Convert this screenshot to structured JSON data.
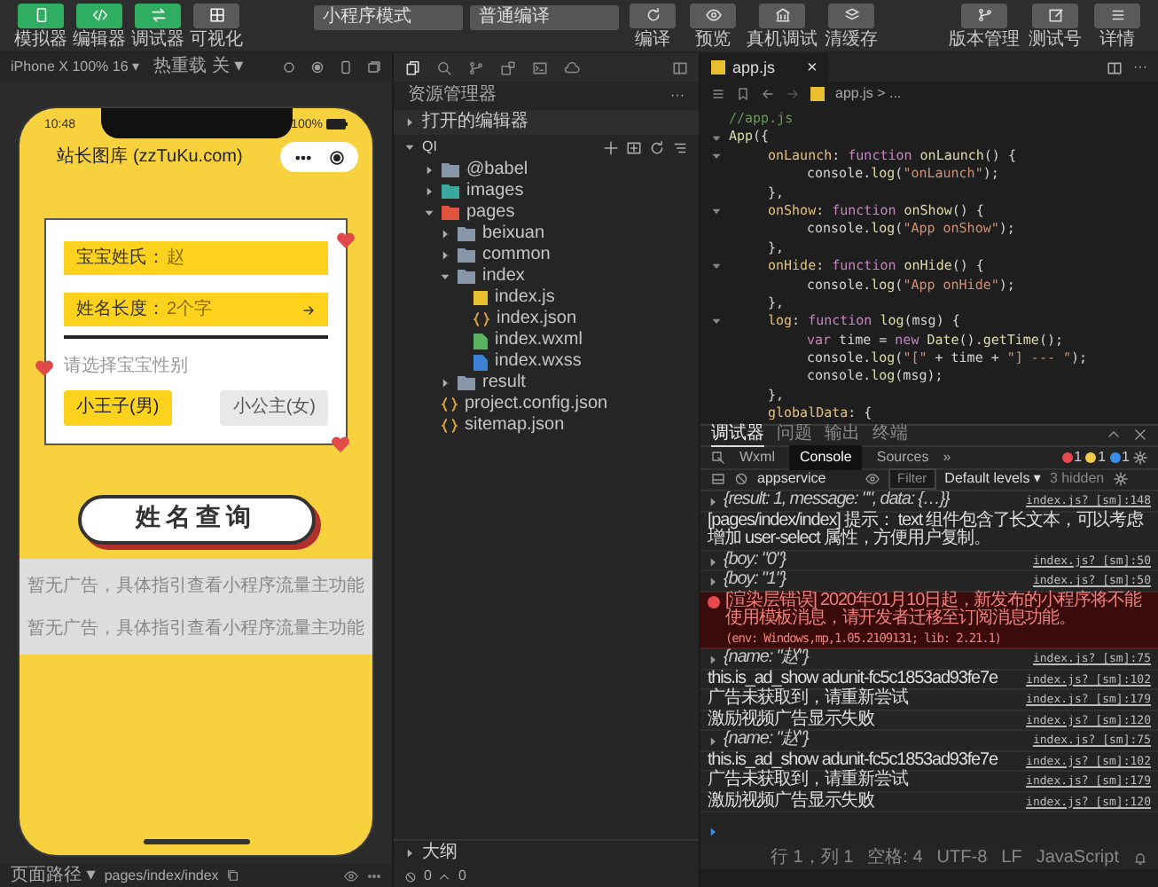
{
  "toolbar": {
    "views": [
      {
        "label": "模拟器",
        "on": true
      },
      {
        "label": "编辑器",
        "on": true
      },
      {
        "label": "调试器",
        "on": true
      },
      {
        "label": "可视化",
        "on": false
      }
    ],
    "mode": "小程序模式",
    "compile": "普通编译",
    "actions": [
      {
        "label": "编译"
      },
      {
        "label": "预览"
      },
      {
        "label": "真机调试"
      },
      {
        "label": "清缓存"
      }
    ],
    "right": [
      {
        "label": "版本管理"
      },
      {
        "label": "测试号"
      },
      {
        "label": "详情"
      }
    ]
  },
  "simulator": {
    "device": "iPhone X 100% 16 ▾",
    "hot_reload": "热重载 关 ▾",
    "phone": {
      "time": "10:48",
      "battery": "100%",
      "title": "站长图库 (zzTuKu.com)",
      "fields": [
        {
          "label": "宝宝姓氏：",
          "value": "赵",
          "arrow": false
        },
        {
          "label": "姓名长度：",
          "value": "2个字",
          "arrow": true
        }
      ],
      "gender_prompt": "请选择宝宝性别",
      "genders": [
        {
          "label": "小王子(男)",
          "selected": true
        },
        {
          "label": "小公主(女)",
          "selected": false
        }
      ],
      "submit": "姓名查询",
      "ads": [
        "暂无广告，具体指引查看小程序流量主功能",
        "暂无广告，具体指引查看小程序流量主功能"
      ]
    },
    "page_path_label": "页面路径 ▾",
    "page_path": "pages/index/index"
  },
  "explorer": {
    "title": "资源管理器",
    "more": "···",
    "open_editors": {
      "label": "打开的编辑器",
      "expanded": false
    },
    "project": {
      "label": "QI",
      "expanded": true,
      "children": [
        {
          "name": "@babel",
          "kind": "folder",
          "color": "#8796a8",
          "expanded": false
        },
        {
          "name": "images",
          "kind": "folder",
          "color": "#3aa89c",
          "expanded": false
        },
        {
          "name": "pages",
          "kind": "folder",
          "color": "#e0533f",
          "expanded": true,
          "children": [
            {
              "name": "beixuan",
              "kind": "folder",
              "color": "#8796a8",
              "expanded": false
            },
            {
              "name": "common",
              "kind": "folder",
              "color": "#8796a8",
              "expanded": false
            },
            {
              "name": "index",
              "kind": "folder",
              "color": "#8796a8",
              "expanded": true,
              "children": [
                {
                  "name": "index.js",
                  "kind": "js"
                },
                {
                  "name": "index.json",
                  "kind": "json"
                },
                {
                  "name": "index.wxml",
                  "kind": "wxml"
                },
                {
                  "name": "index.wxss",
                  "kind": "wxss"
                }
              ]
            },
            {
              "name": "result",
              "kind": "folder",
              "color": "#8796a8",
              "expanded": false
            }
          ]
        },
        {
          "name": "project.config.json",
          "kind": "json"
        },
        {
          "name": "sitemap.json",
          "kind": "json"
        }
      ]
    },
    "outline": "大纲",
    "errors": "0",
    "warnings": "0"
  },
  "editor": {
    "tab": "app.js",
    "close": "×",
    "breadcrumb": "app.js > ...",
    "more": "···",
    "lines": [
      {
        "tokens": [
          {
            "kind": "comment",
            "text": "//app.js"
          }
        ]
      },
      {
        "tokens": [
          {
            "kind": "fn",
            "text": "App"
          },
          {
            "kind": "plain",
            "text": "({"
          }
        ],
        "children": [
          {
            "tokens": [
              {
                "kind": "key",
                "text": "onLaunch"
              },
              {
                "kind": "plain",
                "text": ": "
              },
              {
                "kind": "kw",
                "text": "function"
              },
              {
                "kind": "fn",
                "text": " onLaunch"
              },
              {
                "kind": "plain",
                "text": "() {"
              }
            ],
            "children": [
              {
                "tokens": [
                  {
                    "kind": "plain",
                    "text": "console."
                  },
                  {
                    "kind": "fn",
                    "text": "log"
                  },
                  {
                    "kind": "plain",
                    "text": "("
                  },
                  {
                    "kind": "str",
                    "text": "\"onLaunch\""
                  },
                  {
                    "kind": "plain",
                    "text": ");"
                  }
                ]
              }
            ]
          },
          {
            "tokens": [
              {
                "kind": "plain",
                "text": "},"
              }
            ]
          },
          {
            "tokens": [
              {
                "kind": "key",
                "text": "onShow"
              },
              {
                "kind": "plain",
                "text": ": "
              },
              {
                "kind": "kw",
                "text": "function"
              },
              {
                "kind": "fn",
                "text": " onShow"
              },
              {
                "kind": "plain",
                "text": "() {"
              }
            ],
            "children": [
              {
                "tokens": [
                  {
                    "kind": "plain",
                    "text": "console."
                  },
                  {
                    "kind": "fn",
                    "text": "log"
                  },
                  {
                    "kind": "plain",
                    "text": "("
                  },
                  {
                    "kind": "str",
                    "text": "\"App onShow\""
                  },
                  {
                    "kind": "plain",
                    "text": ");"
                  }
                ]
              }
            ]
          },
          {
            "tokens": [
              {
                "kind": "plain",
                "text": "},"
              }
            ]
          },
          {
            "tokens": [
              {
                "kind": "key",
                "text": "onHide"
              },
              {
                "kind": "plain",
                "text": ": "
              },
              {
                "kind": "kw",
                "text": "function"
              },
              {
                "kind": "fn",
                "text": " onHide"
              },
              {
                "kind": "plain",
                "text": "() {"
              }
            ],
            "children": [
              {
                "tokens": [
                  {
                    "kind": "plain",
                    "text": "console."
                  },
                  {
                    "kind": "fn",
                    "text": "log"
                  },
                  {
                    "kind": "plain",
                    "text": "("
                  },
                  {
                    "kind": "str",
                    "text": "\"App onHide\""
                  },
                  {
                    "kind": "plain",
                    "text": ");"
                  }
                ]
              }
            ]
          },
          {
            "tokens": [
              {
                "kind": "plain",
                "text": "},"
              }
            ]
          },
          {
            "tokens": [
              {
                "kind": "key",
                "text": "log"
              },
              {
                "kind": "plain",
                "text": ": "
              },
              {
                "kind": "kw",
                "text": "function"
              },
              {
                "kind": "fn",
                "text": " log"
              },
              {
                "kind": "plain",
                "text": "(msg) {"
              }
            ],
            "children": [
              {
                "tokens": [
                  {
                    "kind": "kw",
                    "text": "var"
                  },
                  {
                    "kind": "plain",
                    "text": " time = "
                  },
                  {
                    "kind": "kw",
                    "text": "new"
                  },
                  {
                    "kind": "fn",
                    "text": " Date"
                  },
                  {
                    "kind": "plain",
                    "text": "()."
                  },
                  {
                    "kind": "fn",
                    "text": "getTime"
                  },
                  {
                    "kind": "plain",
                    "text": "();"
                  }
                ]
              },
              {
                "tokens": [
                  {
                    "kind": "plain",
                    "text": "console."
                  },
                  {
                    "kind": "fn",
                    "text": "log"
                  },
                  {
                    "kind": "plain",
                    "text": "("
                  },
                  {
                    "kind": "str",
                    "text": "\"[\""
                  },
                  {
                    "kind": "plain",
                    "text": " + time + "
                  },
                  {
                    "kind": "str",
                    "text": "\"] --- \""
                  },
                  {
                    "kind": "plain",
                    "text": ");"
                  }
                ]
              },
              {
                "tokens": [
                  {
                    "kind": "plain",
                    "text": "console."
                  },
                  {
                    "kind": "fn",
                    "text": "log"
                  },
                  {
                    "kind": "plain",
                    "text": "(msg);"
                  }
                ]
              }
            ]
          },
          {
            "tokens": [
              {
                "kind": "plain",
                "text": "},"
              }
            ]
          },
          {
            "tokens": [
              {
                "kind": "key",
                "text": "globalData"
              },
              {
                "kind": "plain",
                "text": ": {"
              }
            ]
          }
        ]
      }
    ]
  },
  "console": {
    "panel_tabs": [
      {
        "label": "调试器",
        "selected": true
      },
      {
        "label": "问题",
        "selected": false
      },
      {
        "label": "输出",
        "selected": false
      },
      {
        "label": "终端",
        "selected": false
      }
    ],
    "devtools_tabs": [
      {
        "label": "Wxml",
        "selected": false
      },
      {
        "label": "Console",
        "selected": true
      },
      {
        "label": "Sources",
        "selected": false
      }
    ],
    "overflow": "»",
    "counts": [
      {
        "kind": "error",
        "count": "1"
      },
      {
        "kind": "warning",
        "count": "1"
      },
      {
        "kind": "info",
        "count": "1"
      }
    ],
    "context": "appservice",
    "filter_placeholder": "Filter",
    "levels": "Default levels ▾",
    "hidden": "3 hidden",
    "entries": [
      {
        "kind": "object",
        "text": "{result: 1, message: \"\", data: {…}}",
        "source": "index.js? [sm]:148"
      },
      {
        "kind": "text",
        "text": "[pages/index/index] 提示： text 组件包含了长文本，可以考虑增加 user-select 属性，方便用户复制。"
      },
      {
        "kind": "object",
        "text": "{boy: \"0\"}",
        "source": "index.js? [sm]:50"
      },
      {
        "kind": "object",
        "text": "{boy: \"1\"}",
        "source": "index.js? [sm]:50"
      },
      {
        "kind": "error",
        "text": "[渲染层错误] 2020年01月10日起，新发布的小程序将不能使用模板消息，请开发者迁移至订阅消息功能。",
        "detail": "(env: Windows,mp,1.05.2109131; lib: 2.21.1)"
      },
      {
        "kind": "object",
        "text": "{name: \"赵\"}",
        "source": "index.js? [sm]:75"
      },
      {
        "kind": "text",
        "text": "this.is_ad_show adunit-fc5c1853ad93fe7e",
        "source": "index.js? [sm]:102"
      },
      {
        "kind": "text",
        "text": "广告未获取到，请重新尝试",
        "source": "index.js? [sm]:179"
      },
      {
        "kind": "text",
        "text": "激励视频广告显示失败",
        "source": "index.js? [sm]:120"
      },
      {
        "kind": "object",
        "text": "{name: \"赵\"}",
        "source": "index.js? [sm]:75"
      },
      {
        "kind": "text",
        "text": "this.is_ad_show adunit-fc5c1853ad93fe7e",
        "source": "index.js? [sm]:102"
      },
      {
        "kind": "text",
        "text": "广告未获取到，请重新尝试",
        "source": "index.js? [sm]:179"
      },
      {
        "kind": "text",
        "text": "激励视频广告显示失败",
        "source": "index.js? [sm]:120"
      }
    ]
  },
  "status_bar": [
    "行 1，列 1",
    "空格: 4",
    "UTF-8",
    "LF",
    "JavaScript"
  ]
}
